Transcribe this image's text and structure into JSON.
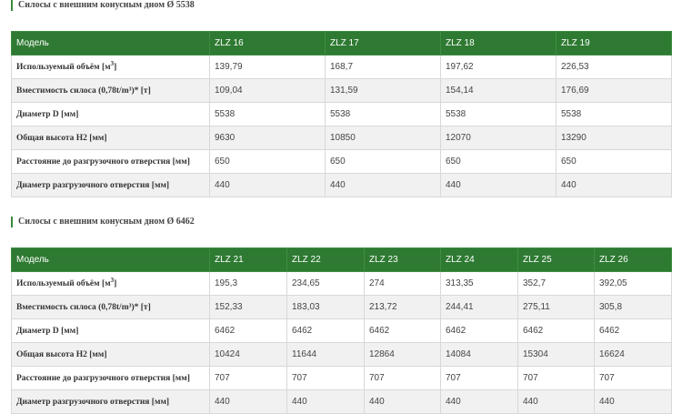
{
  "section1": {
    "title": "Силосы с внешним конусным дном Ø 5538",
    "header": [
      "Модель",
      "ZLZ 16",
      "ZLZ 17",
      "ZLZ 18",
      "ZLZ 19"
    ],
    "rows": [
      {
        "label_pre": "Используемый объём [м",
        "label_sup": "3",
        "label_post": "]",
        "values": [
          "139,79",
          "168,7",
          "197,62",
          "226,53"
        ]
      },
      {
        "label_pre": "Вместимость силоса (0,78t/m³)* [т]",
        "label_sup": "",
        "label_post": "",
        "values": [
          "109,04",
          "131,59",
          "154,14",
          "176,69"
        ]
      },
      {
        "label_pre": "Диаметр D [мм]",
        "label_sup": "",
        "label_post": "",
        "values": [
          "5538",
          "5538",
          "5538",
          "5538"
        ]
      },
      {
        "label_pre": "Общая высота H2 [мм]",
        "label_sup": "",
        "label_post": "",
        "values": [
          "9630",
          "10850",
          "12070",
          "13290"
        ]
      },
      {
        "label_pre": "Расстояние до разгрузочного отверстия [мм]",
        "label_sup": "",
        "label_post": "",
        "values": [
          "650",
          "650",
          "650",
          "650"
        ]
      },
      {
        "label_pre": "Диаметр разгрузочного отверстия [мм]",
        "label_sup": "",
        "label_post": "",
        "values": [
          "440",
          "440",
          "440",
          "440"
        ]
      }
    ]
  },
  "section2": {
    "title": "Силосы с внешним конусным дном Ø 6462",
    "header": [
      "Модель",
      "ZLZ 21",
      "ZLZ 22",
      "ZLZ 23",
      "ZLZ 24",
      "ZLZ 25",
      "ZLZ 26"
    ],
    "rows": [
      {
        "label_pre": "Используемый объём [м",
        "label_sup": "3",
        "label_post": "]",
        "values": [
          "195,3",
          "234,65",
          "274",
          "313,35",
          "352,7",
          "392,05"
        ]
      },
      {
        "label_pre": "Вместимость силоса (0,78t/m³)* [т]",
        "label_sup": "",
        "label_post": "",
        "values": [
          "152,33",
          "183,03",
          "213,72",
          "244,41",
          "275,11",
          "305,8"
        ]
      },
      {
        "label_pre": "Диаметр D [мм]",
        "label_sup": "",
        "label_post": "",
        "values": [
          "6462",
          "6462",
          "6462",
          "6462",
          "6462",
          "6462"
        ]
      },
      {
        "label_pre": "Общая высота H2 [мм]",
        "label_sup": "",
        "label_post": "",
        "values": [
          "10424",
          "11644",
          "12864",
          "14084",
          "15304",
          "16624"
        ]
      },
      {
        "label_pre": "Расстояние до разгрузочного отверстия [мм]",
        "label_sup": "",
        "label_post": "",
        "values": [
          "707",
          "707",
          "707",
          "707",
          "707",
          "707"
        ]
      },
      {
        "label_pre": "Диаметр разгрузочного отверстия [мм]",
        "label_sup": "",
        "label_post": "",
        "values": [
          "440",
          "440",
          "440",
          "440",
          "440",
          "440"
        ]
      }
    ]
  },
  "colors": {
    "header_green": "#2f7a33",
    "row_alt": "#f1f1f1",
    "accent_bar": "#3a8a3a"
  }
}
